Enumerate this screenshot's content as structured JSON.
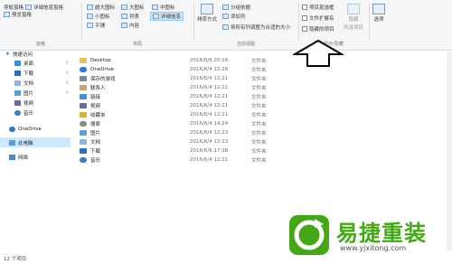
{
  "ribbon": {
    "pane": {
      "nav_pane": "导航窗格",
      "preview_pane": "预览窗格",
      "details_pane": "详细信息窗格",
      "group_label": "窗格"
    },
    "layout": {
      "extra_large_icons": "超大图标",
      "large_icons": "大图标",
      "medium_icons": "中图标",
      "small_icons": "小图标",
      "list": "列表",
      "details": "详细信息",
      "tiles": "平铺",
      "content": "内容",
      "group_label": "布局"
    },
    "current_view": {
      "sort_by": "排序方式",
      "group_by": "分组依据",
      "add_columns": "添加列",
      "size_all_columns": "将所有列调整为合适的大小",
      "group_label": "当前视图"
    },
    "show_hide": {
      "item_check_boxes": "项目复选框",
      "file_name_extensions": "文件扩展名",
      "hidden_items": "隐藏的项目",
      "hide_selected": "隐藏",
      "hide_selected_2": "所选项目",
      "group_label": "显示/隐藏"
    },
    "options": "选项"
  },
  "nav": {
    "quick_access": "快速访问",
    "items": [
      {
        "label": "桌面",
        "pinned": true
      },
      {
        "label": "下载",
        "pinned": true
      },
      {
        "label": "文档",
        "pinned": true
      },
      {
        "label": "图片",
        "pinned": true
      },
      {
        "label": "视频",
        "pinned": false
      },
      {
        "label": "音乐",
        "pinned": false
      }
    ],
    "onedrive": "OneDrive",
    "this_pc": "此电脑",
    "network": "网络"
  },
  "files": [
    {
      "name": "Desktop",
      "date": "2016/6/6 20:16",
      "type": "文件夹"
    },
    {
      "name": "OneDrive",
      "date": "2016/6/4 12:26",
      "type": "文件夹"
    },
    {
      "name": "保存的游戏",
      "date": "2016/6/4 12:21",
      "type": "文件夹"
    },
    {
      "name": "联系人",
      "date": "2016/6/4 12:21",
      "type": "文件夹"
    },
    {
      "name": "链接",
      "date": "2016/6/4 12:21",
      "type": "文件夹"
    },
    {
      "name": "视频",
      "date": "2016/6/4 12:21",
      "type": "文件夹"
    },
    {
      "name": "收藏夹",
      "date": "2016/6/4 12:21",
      "type": "文件夹"
    },
    {
      "name": "搜索",
      "date": "2016/6/4 14:24",
      "type": "文件夹"
    },
    {
      "name": "图片",
      "date": "2016/6/4 12:23",
      "type": "文件夹"
    },
    {
      "name": "文档",
      "date": "2016/6/4 12:23",
      "type": "文件夹"
    },
    {
      "name": "下载",
      "date": "2016/6/6 17:38",
      "type": "文件夹"
    },
    {
      "name": "音乐",
      "date": "2016/6/4 12:21",
      "type": "文件夹"
    }
  ],
  "status": {
    "item_count": "12 个项目"
  },
  "watermark": {
    "brand": "易捷重装",
    "url": "www.yjxitong.com"
  },
  "colors": {
    "ribbon_bg": "#f5f6f7",
    "selected_bg": "#cce8ff",
    "folder_yellow": "#e8c15a",
    "watermark_green": "#44a815"
  }
}
